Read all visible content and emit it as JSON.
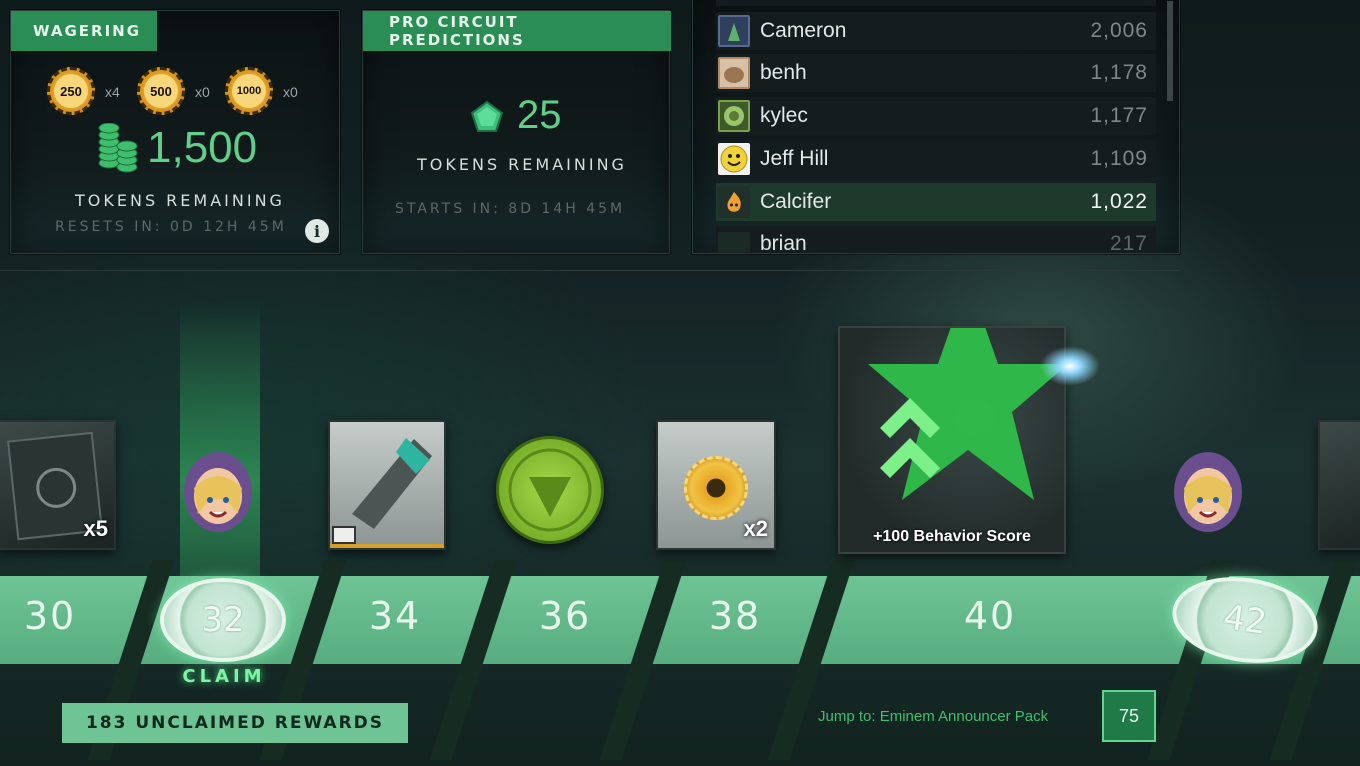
{
  "wagering": {
    "header": "WAGERING",
    "chips": [
      {
        "value": "250",
        "count": "x4"
      },
      {
        "value": "500",
        "count": "x0"
      },
      {
        "value": "1000",
        "count": "x0"
      }
    ],
    "tokens": "1,500",
    "tokens_label": "TOKENS REMAINING",
    "resets": "RESETS IN: 0D 12H 45M",
    "info_icon": "i"
  },
  "predictions": {
    "header": "PRO CIRCUIT PREDICTIONS",
    "tokens": "25",
    "tokens_label": "TOKENS REMAINING",
    "starts": "STARTS IN: 8D 14H 45M"
  },
  "leaderboard": {
    "rows": [
      {
        "name": "Cameron",
        "score": "2,006",
        "avatar_color": "#5a6a8c"
      },
      {
        "name": "benh",
        "score": "1,178",
        "avatar_color": "#b08a6a"
      },
      {
        "name": "kylec",
        "score": "1,177",
        "avatar_color": "#7aa04a"
      },
      {
        "name": "Jeff Hill",
        "score": "1,109",
        "avatar_color": "#f2d23a"
      },
      {
        "name": "Calcifer",
        "score": "1,022",
        "avatar_color": "#e8902a",
        "highlight": true
      },
      {
        "name": "brian",
        "score": "217",
        "avatar_color": "#2a5a4a"
      }
    ]
  },
  "track": {
    "levels": [
      "30",
      "32",
      "34",
      "36",
      "38",
      "40",
      "42"
    ],
    "claim_label": "CLAIM",
    "rewards": [
      {
        "qty": "x5"
      },
      {
        "qty": "x2"
      },
      {
        "label": "+100 Behavior Score"
      }
    ]
  },
  "footer": {
    "unclaimed": "183 UNCLAIMED REWARDS",
    "jump_label": "Jump to: Eminem Announcer Pack",
    "jump_level": "75"
  },
  "colors": {
    "accent_green": "#2a8d55",
    "token_green": "#5fcf8a",
    "gold": "#e7a626"
  }
}
